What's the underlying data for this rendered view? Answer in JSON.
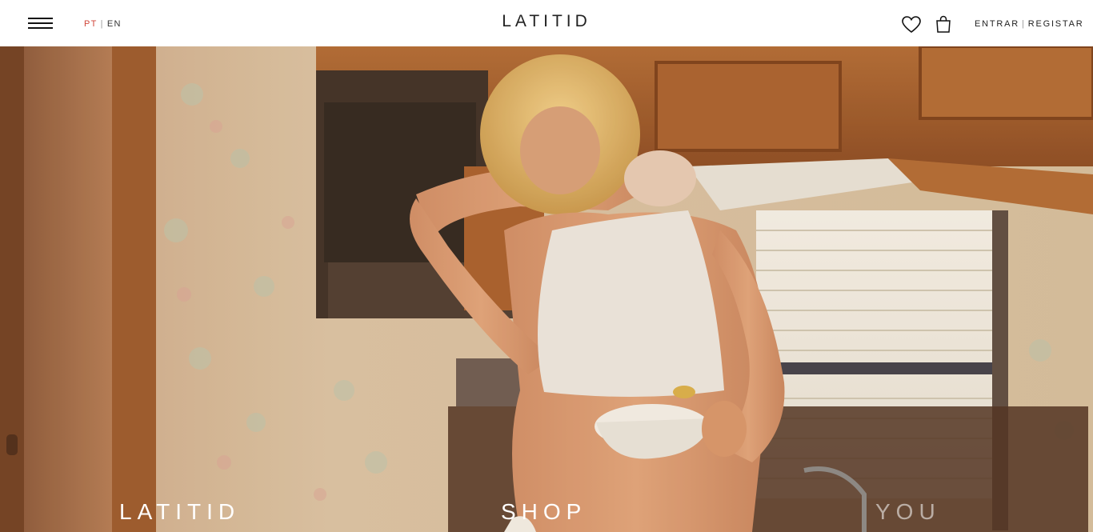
{
  "header": {
    "logo": "LATITID",
    "languages": {
      "active": "PT",
      "separator": "|",
      "other": "EN"
    },
    "account": {
      "login": "ENTRAR",
      "separator": "|",
      "register": "REGISTAR"
    },
    "icons": [
      "menu-icon",
      "heart-icon",
      "bag-icon"
    ]
  },
  "hero": {
    "links": {
      "latitid": "LATITID",
      "shop": "SHOP",
      "you": "YOU"
    }
  },
  "colors": {
    "accent": "#d0463a",
    "text": "#222222",
    "hero_text": "#ffffff"
  }
}
